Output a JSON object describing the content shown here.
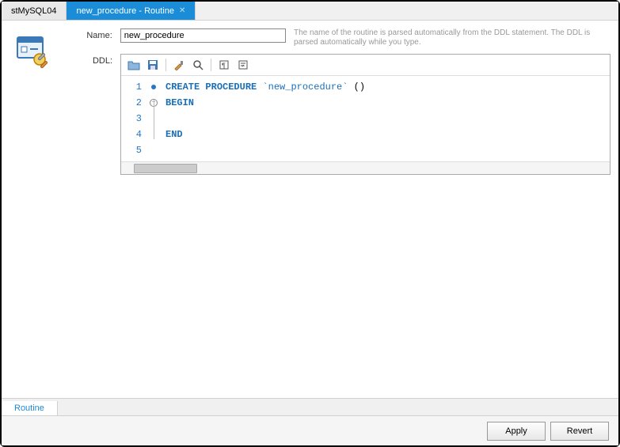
{
  "tabs": [
    {
      "label": "stMySQL04",
      "active": false,
      "closable": false
    },
    {
      "label": "new_procedure - Routine",
      "active": true,
      "closable": true
    }
  ],
  "form": {
    "name_label": "Name:",
    "name_value": "new_procedure",
    "ddl_label": "DDL:",
    "hint": "The name of the routine is parsed automatically from the DDL statement. The DDL is parsed automatically while you type."
  },
  "editor": {
    "lines": [
      {
        "n": 1,
        "marker": "dot",
        "tokens": [
          [
            "kw",
            "CREATE"
          ],
          [
            "plain",
            " "
          ],
          [
            "kw",
            "PROCEDURE"
          ],
          [
            "plain",
            " "
          ],
          [
            "bt",
            "`new_procedure`"
          ],
          [
            "plain",
            " ()"
          ]
        ]
      },
      {
        "n": 2,
        "marker": "fold",
        "tokens": [
          [
            "kw",
            "BEGIN"
          ]
        ]
      },
      {
        "n": 3,
        "marker": "",
        "tokens": []
      },
      {
        "n": 4,
        "marker": "",
        "tokens": [
          [
            "kw",
            "END"
          ]
        ]
      },
      {
        "n": 5,
        "marker": "",
        "tokens": []
      }
    ]
  },
  "bottom_tab": "Routine",
  "buttons": {
    "apply": "Apply",
    "revert": "Revert"
  }
}
